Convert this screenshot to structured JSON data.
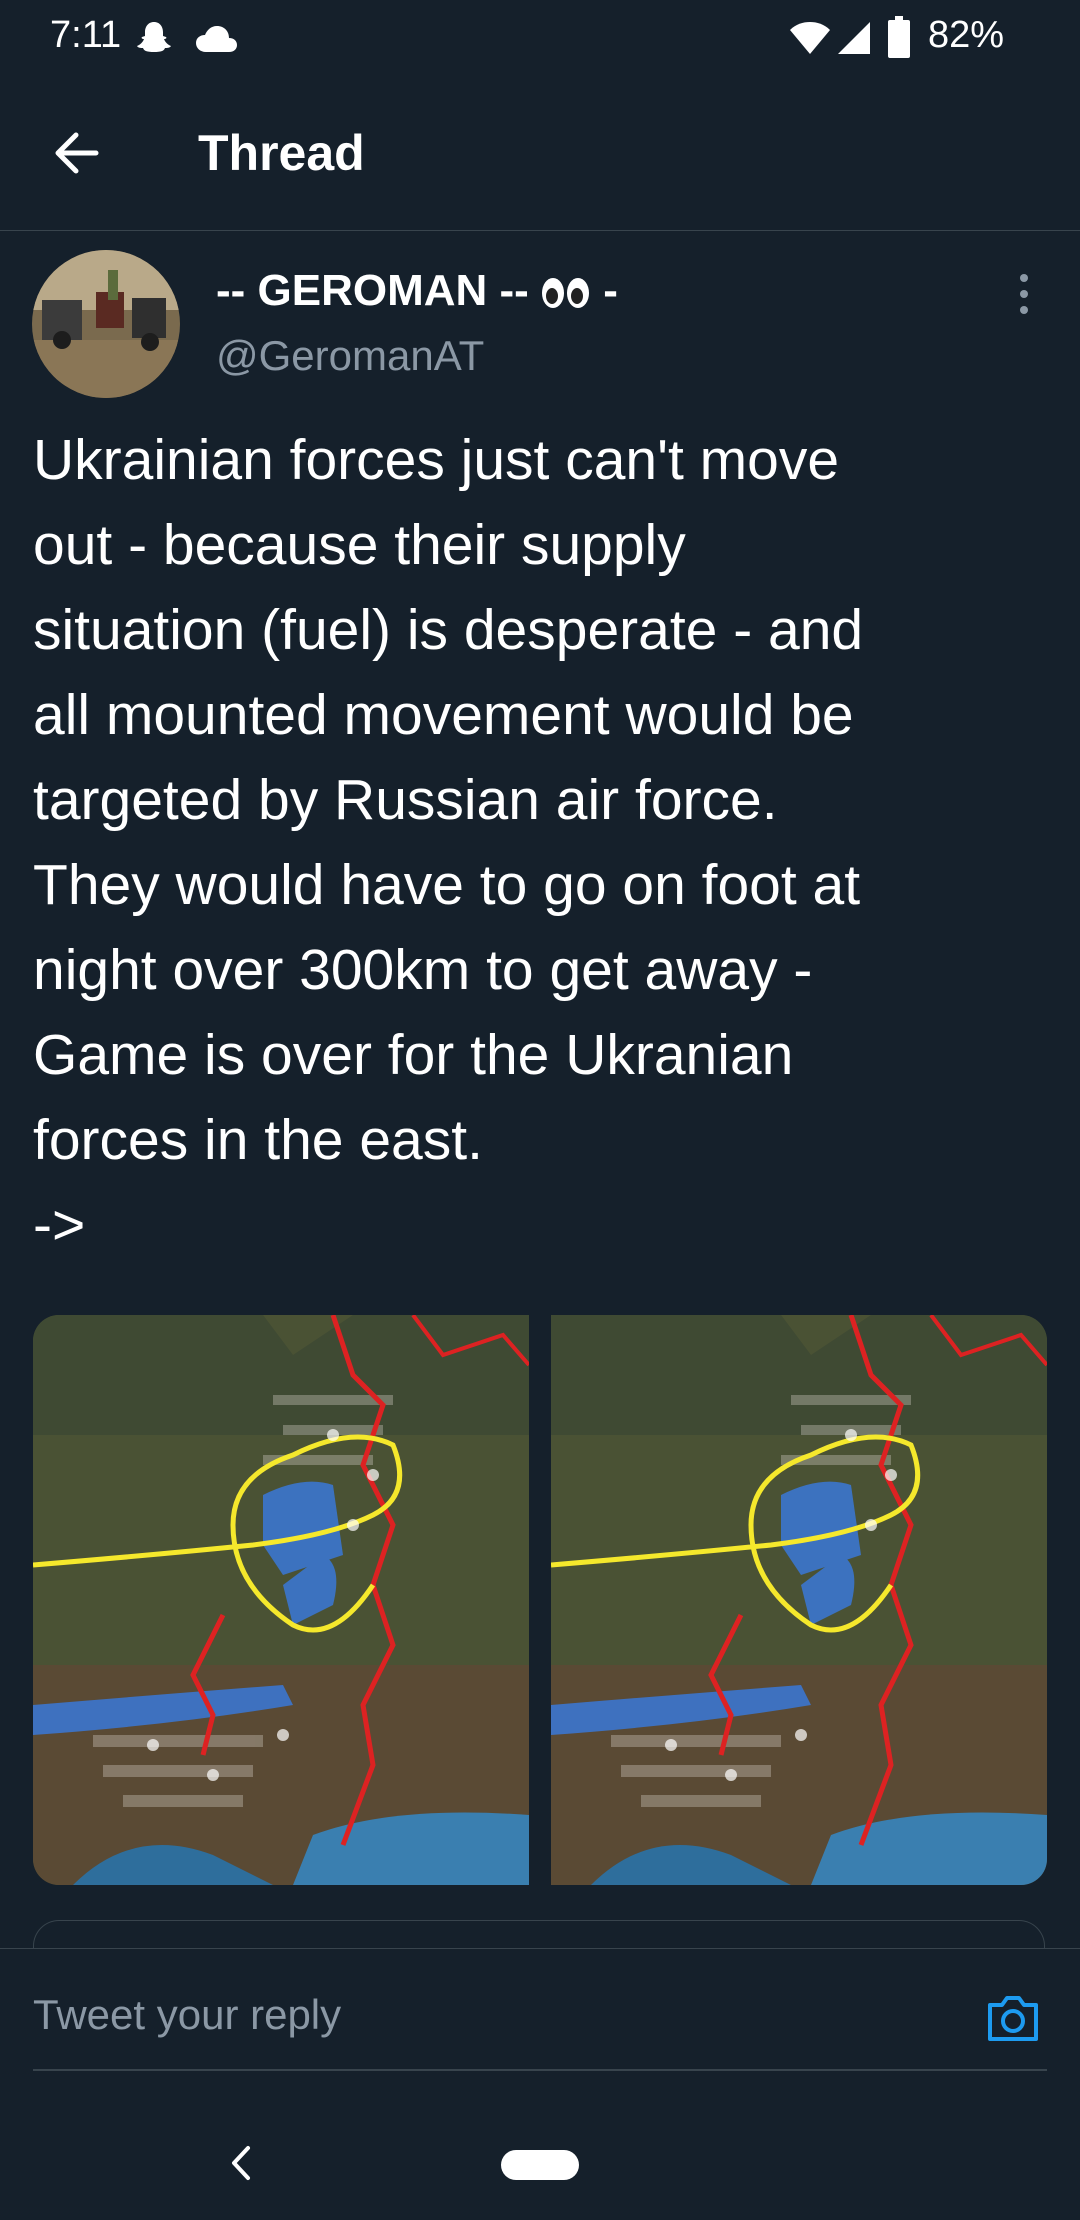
{
  "status_bar": {
    "time": "7:11",
    "battery": "82%",
    "icons": [
      "snapchat-icon",
      "cloud-icon",
      "wifi-icon",
      "signal-icon",
      "battery-icon"
    ]
  },
  "header": {
    "title": "Thread",
    "back_icon": "arrow-left-icon"
  },
  "tweet": {
    "display_name": "-- GEROMAN -- ",
    "display_name_suffix": " -",
    "handle": "@GeromanAT",
    "text": "Ukrainian forces just can't move\nout - because their supply\nsituation (fuel) is desperate - and\nall mounted movement would be\ntargeted by Russian air force.\nThey would have to go on foot at\nnight over 300km to get away -\nGame is over for the Ukranian\nforces in the east.\n->",
    "more_icon": "more-vertical-icon",
    "media_count": 2
  },
  "reply": {
    "placeholder": "Tweet your reply",
    "camera_icon": "camera-icon"
  },
  "colors": {
    "background": "#15202b",
    "secondary_text": "#8b98a5",
    "accent": "#1d9bf0",
    "divider": "#38444d"
  }
}
